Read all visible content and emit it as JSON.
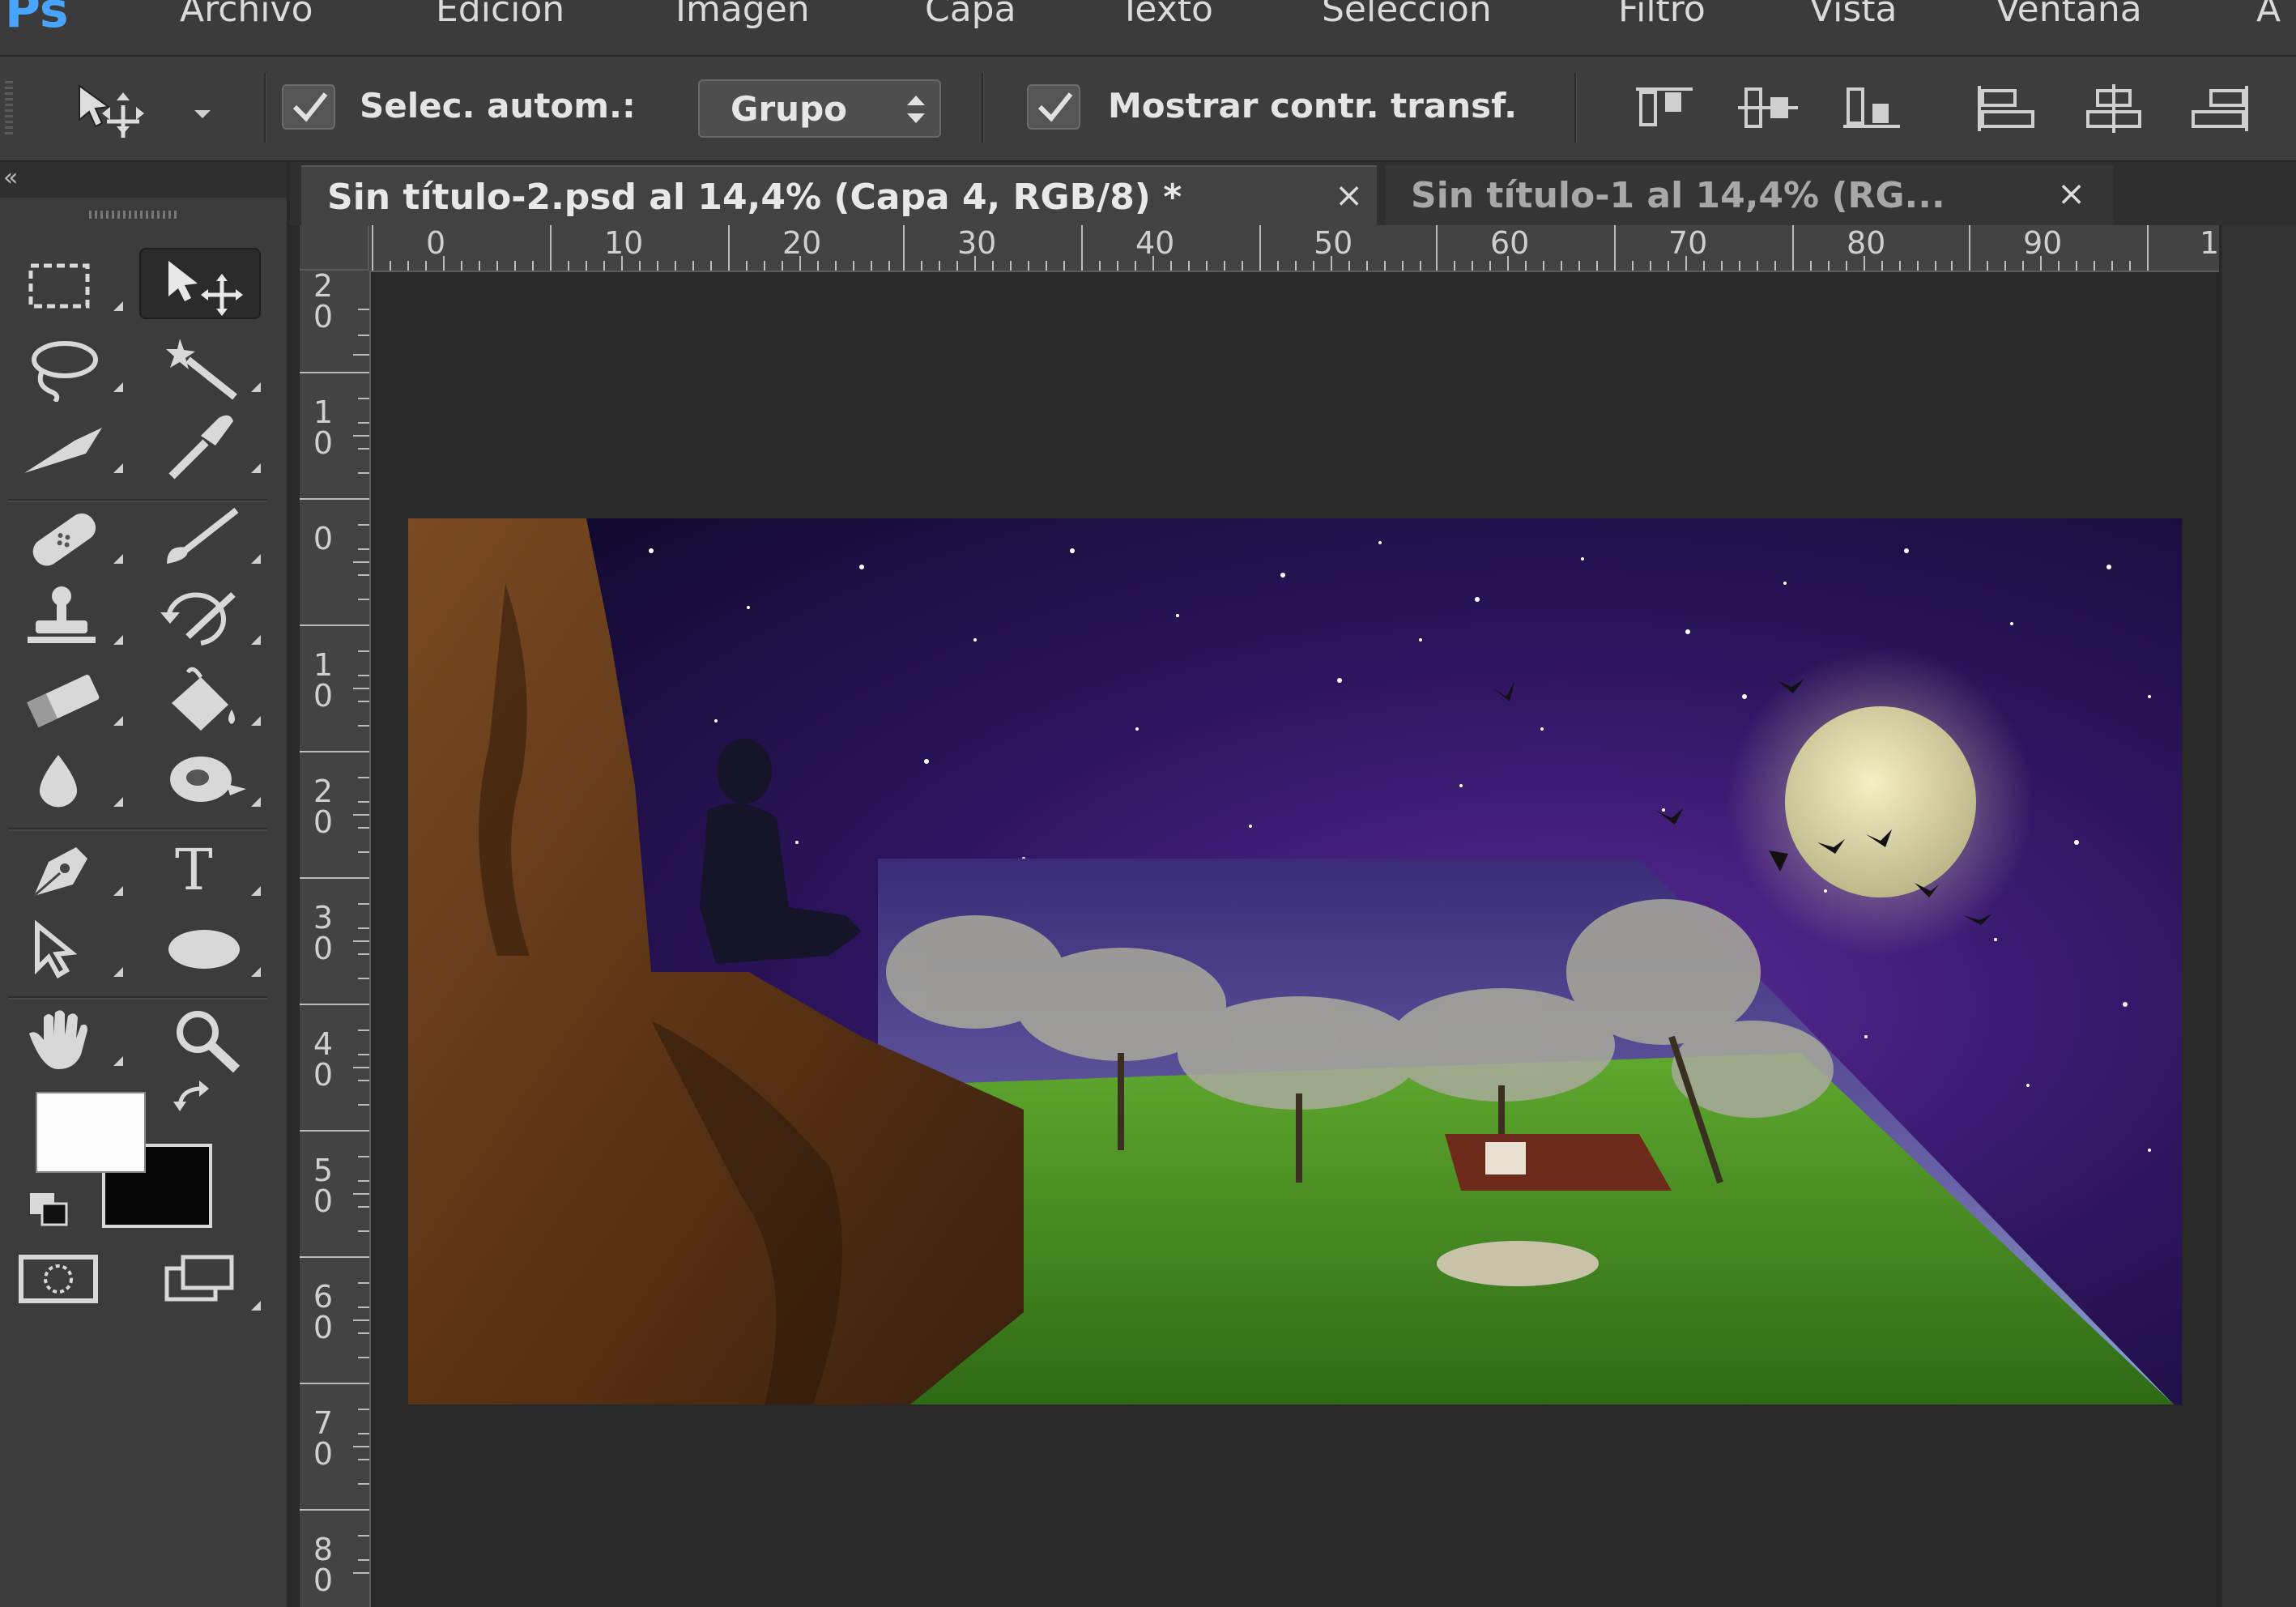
{
  "app": {
    "logo": "Ps"
  },
  "menu": [
    "Archivo",
    "Edición",
    "Imagen",
    "Capa",
    "Texto",
    "Selección",
    "Filtro",
    "Vista",
    "Ventana",
    "A"
  ],
  "options": {
    "auto_select_label": "Selec. autom.:",
    "auto_select_checked": true,
    "group_value": "Grupo",
    "show_transform_label": "Mostrar contr. transf.",
    "show_transform_checked": true
  },
  "toolbox": {
    "collapse_icon": "«"
  },
  "tabs": [
    {
      "title": "Sin título-2.psd al 14,4% (Capa 4, RGB/8) *",
      "close": "×",
      "active": true
    },
    {
      "title": "Sin título-1 al 14,4% (RG...",
      "close": "×",
      "active": false
    }
  ],
  "ruler": {
    "top": [
      "0",
      "10",
      "20",
      "30",
      "40",
      "50",
      "60",
      "70",
      "80",
      "90",
      "1"
    ],
    "left": [
      [
        "2",
        "0"
      ],
      [
        "1",
        "0"
      ],
      [
        "0",
        ""
      ],
      [
        "1",
        "0"
      ],
      [
        "2",
        "0"
      ],
      [
        "3",
        "0"
      ],
      [
        "4",
        "0"
      ],
      [
        "5",
        "0"
      ],
      [
        "6",
        "0"
      ],
      [
        "7",
        "0"
      ],
      [
        "8",
        "0"
      ]
    ]
  },
  "colors": {
    "foreground": "#fafafa",
    "background": "#050505",
    "accent": "#47a4ff"
  }
}
